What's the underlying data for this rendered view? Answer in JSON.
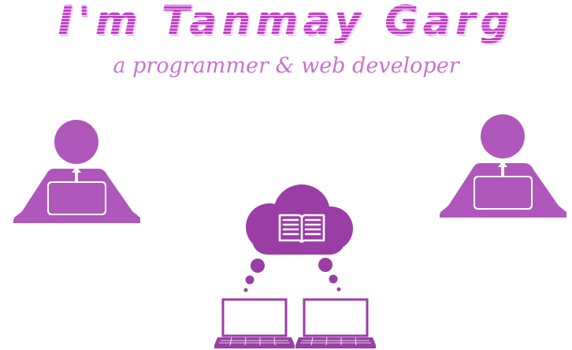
{
  "header": {
    "title": "I'm Tanmay Garg",
    "subtitle": "a programmer & web developer"
  },
  "colors": {
    "figure": "#b057bc",
    "cloud": "#9a3ea5",
    "laptop": "#9a3ea5",
    "title": "#c33fc9",
    "subtitle": "#c974cf"
  },
  "icons": {
    "left_person": "person-at-laptop-icon",
    "right_person": "person-at-laptop-icon",
    "cloud": "cloud-book-icon",
    "laptops": "laptop-icon"
  }
}
